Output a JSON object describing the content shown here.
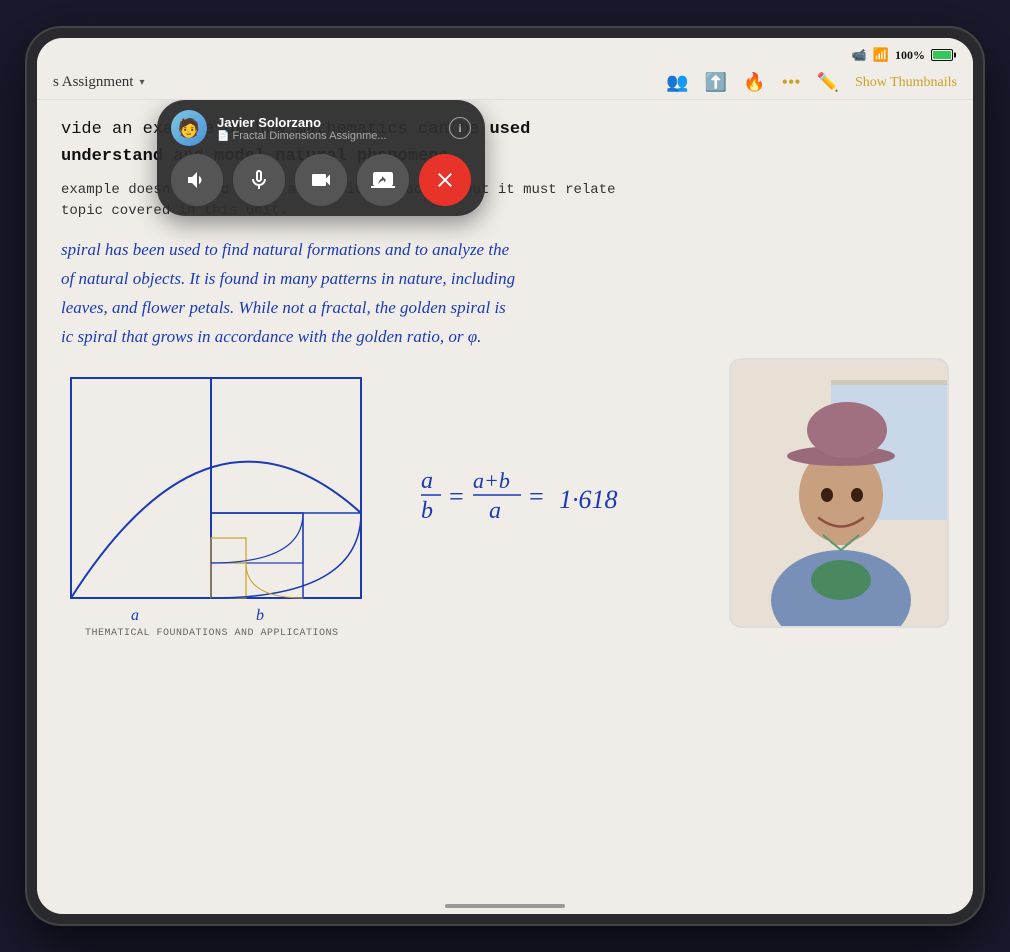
{
  "device": {
    "type": "iPad"
  },
  "status_bar": {
    "battery_percent": "100%",
    "wifi": "WiFi",
    "camera_active": true
  },
  "toolbar": {
    "doc_title": "s Assignment",
    "chevron": "▾",
    "show_thumbnails": "Show Thumbnails",
    "icons": {
      "collaborate": "👥",
      "share": "⬆",
      "markup": "🔥",
      "more": "•••",
      "pencil": "✏️"
    }
  },
  "content": {
    "typed_line1": "vide an example of how mathematics can be ",
    "typed_bold1": "used",
    "typed_line2": "understand",
    "typed_line2b": " and ",
    "typed_bold2": "model natural phenomena",
    "typed_line2c": ".",
    "typed_line3": "example doesn't need to be a classical fractal, but it must relate",
    "typed_line4": "topic covered in this unit.",
    "handwritten": [
      "spiral has been used to find natural formations  and to analyze the",
      "of natural  objects. It is found in many patterns  in nature, including",
      "leaves, and flower petals. While not a fractal, the golden spiral is",
      "ic spiral that grows in accordance with the golden ratio, or φ."
    ],
    "formula": "a/b = (a+b)/a = 1.618...",
    "footer": "THEMATICAL FOUNDATIONS AND APPLICATIONS",
    "axis_a": "a",
    "axis_b": "b"
  },
  "facetime": {
    "user_name": "Javier Solorzano",
    "doc_name": "Fractal Dimensions Assignme...",
    "avatar_emoji": "🧑",
    "controls": {
      "speaker": "🔊",
      "mute": "🎤",
      "camera": "📷",
      "share_screen": "📲",
      "end_call": "✕"
    }
  }
}
